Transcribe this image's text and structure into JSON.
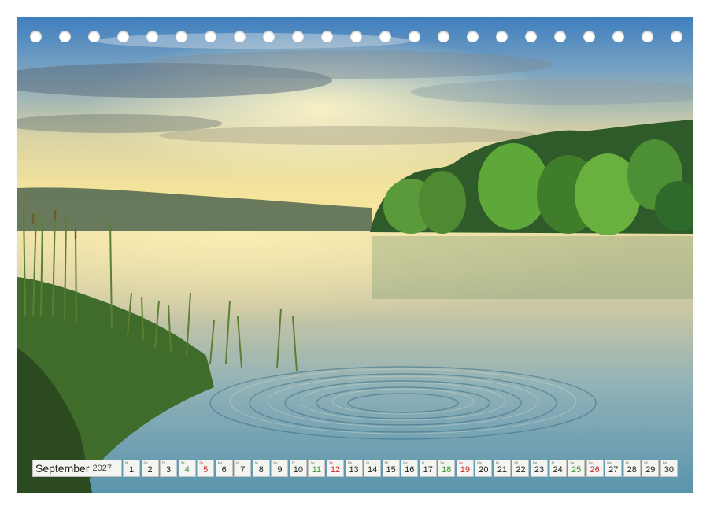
{
  "calendar": {
    "month": "September",
    "year": "2027",
    "days": [
      {
        "wd": "Mi",
        "n": "1",
        "t": "w"
      },
      {
        "wd": "Do",
        "n": "2",
        "t": "w"
      },
      {
        "wd": "Fr",
        "n": "3",
        "t": "w"
      },
      {
        "wd": "Sa",
        "n": "4",
        "t": "sat"
      },
      {
        "wd": "So",
        "n": "5",
        "t": "sun"
      },
      {
        "wd": "Mo",
        "n": "6",
        "t": "w"
      },
      {
        "wd": "Di",
        "n": "7",
        "t": "w"
      },
      {
        "wd": "Mi",
        "n": "8",
        "t": "w"
      },
      {
        "wd": "Do",
        "n": "9",
        "t": "w"
      },
      {
        "wd": "Fr",
        "n": "10",
        "t": "w"
      },
      {
        "wd": "Sa",
        "n": "11",
        "t": "sat"
      },
      {
        "wd": "So",
        "n": "12",
        "t": "sun"
      },
      {
        "wd": "Mo",
        "n": "13",
        "t": "w"
      },
      {
        "wd": "Di",
        "n": "14",
        "t": "w"
      },
      {
        "wd": "Mi",
        "n": "15",
        "t": "w"
      },
      {
        "wd": "Do",
        "n": "16",
        "t": "w"
      },
      {
        "wd": "Fr",
        "n": "17",
        "t": "w"
      },
      {
        "wd": "Sa",
        "n": "18",
        "t": "sat"
      },
      {
        "wd": "So",
        "n": "19",
        "t": "sun"
      },
      {
        "wd": "Mo",
        "n": "20",
        "t": "w"
      },
      {
        "wd": "Di",
        "n": "21",
        "t": "w"
      },
      {
        "wd": "Mi",
        "n": "22",
        "t": "w"
      },
      {
        "wd": "Do",
        "n": "23",
        "t": "w"
      },
      {
        "wd": "Fr",
        "n": "24",
        "t": "w"
      },
      {
        "wd": "Sa",
        "n": "25",
        "t": "sat"
      },
      {
        "wd": "So",
        "n": "26",
        "t": "sun"
      },
      {
        "wd": "Mo",
        "n": "27",
        "t": "w"
      },
      {
        "wd": "Di",
        "n": "28",
        "t": "w"
      },
      {
        "wd": "Mi",
        "n": "29",
        "t": "w"
      },
      {
        "wd": "Do",
        "n": "30",
        "t": "w"
      }
    ]
  },
  "colors": {
    "saturday": "#3a9a3a",
    "sunday": "#cc2a2a"
  }
}
